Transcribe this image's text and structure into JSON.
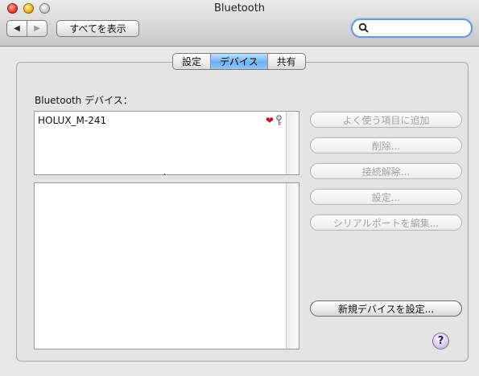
{
  "window": {
    "title": "Bluetooth"
  },
  "toolbar": {
    "back_glyph": "◀",
    "forward_glyph": "▶",
    "show_all_label": "すべてを表示",
    "search_value": ""
  },
  "tabs": [
    {
      "label": "設定",
      "selected": false
    },
    {
      "label": "デバイス",
      "selected": true
    },
    {
      "label": "共有",
      "selected": false
    }
  ],
  "devices": {
    "label": "Bluetooth デバイス：",
    "items": [
      {
        "name": "HOLUX_M-241",
        "favorite_icon": "heart-icon",
        "paired_icon": "key-icon"
      }
    ],
    "splitter_glyph": "ˆ"
  },
  "actions": {
    "add_favorites": "よく使う項目に追加",
    "delete": "削除...",
    "disconnect": "接続解除...",
    "settings": "設定...",
    "edit_serial_ports": "シリアルポートを編集...",
    "setup_new_device": "新規デバイスを設定..."
  },
  "help": {
    "glyph": "?"
  },
  "colors": {
    "selected_tab": "#6fb1f0",
    "heart": "#c71024",
    "search_focus": "#6b98d6"
  }
}
